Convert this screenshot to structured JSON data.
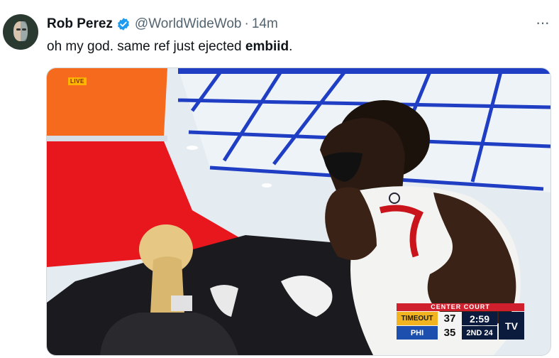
{
  "tweet": {
    "author_name": "Rob Perez",
    "handle": "@WorldWideWob",
    "separator": "·",
    "timestamp": "14m",
    "more_label": "···",
    "text_prefix": "oh my god. same ref just ejected ",
    "text_bold": "embiid",
    "text_suffix": ".",
    "verified_color": "#1d9bf0"
  },
  "video": {
    "live_badge": "LIVE",
    "scorebug": {
      "banner": "CENTER COURT",
      "rows": [
        {
          "team": "TIMEOUT",
          "score": "37",
          "info": "2:59"
        },
        {
          "team": "PHI",
          "score": "35",
          "info": "2ND 24"
        }
      ],
      "network": "TV"
    }
  }
}
